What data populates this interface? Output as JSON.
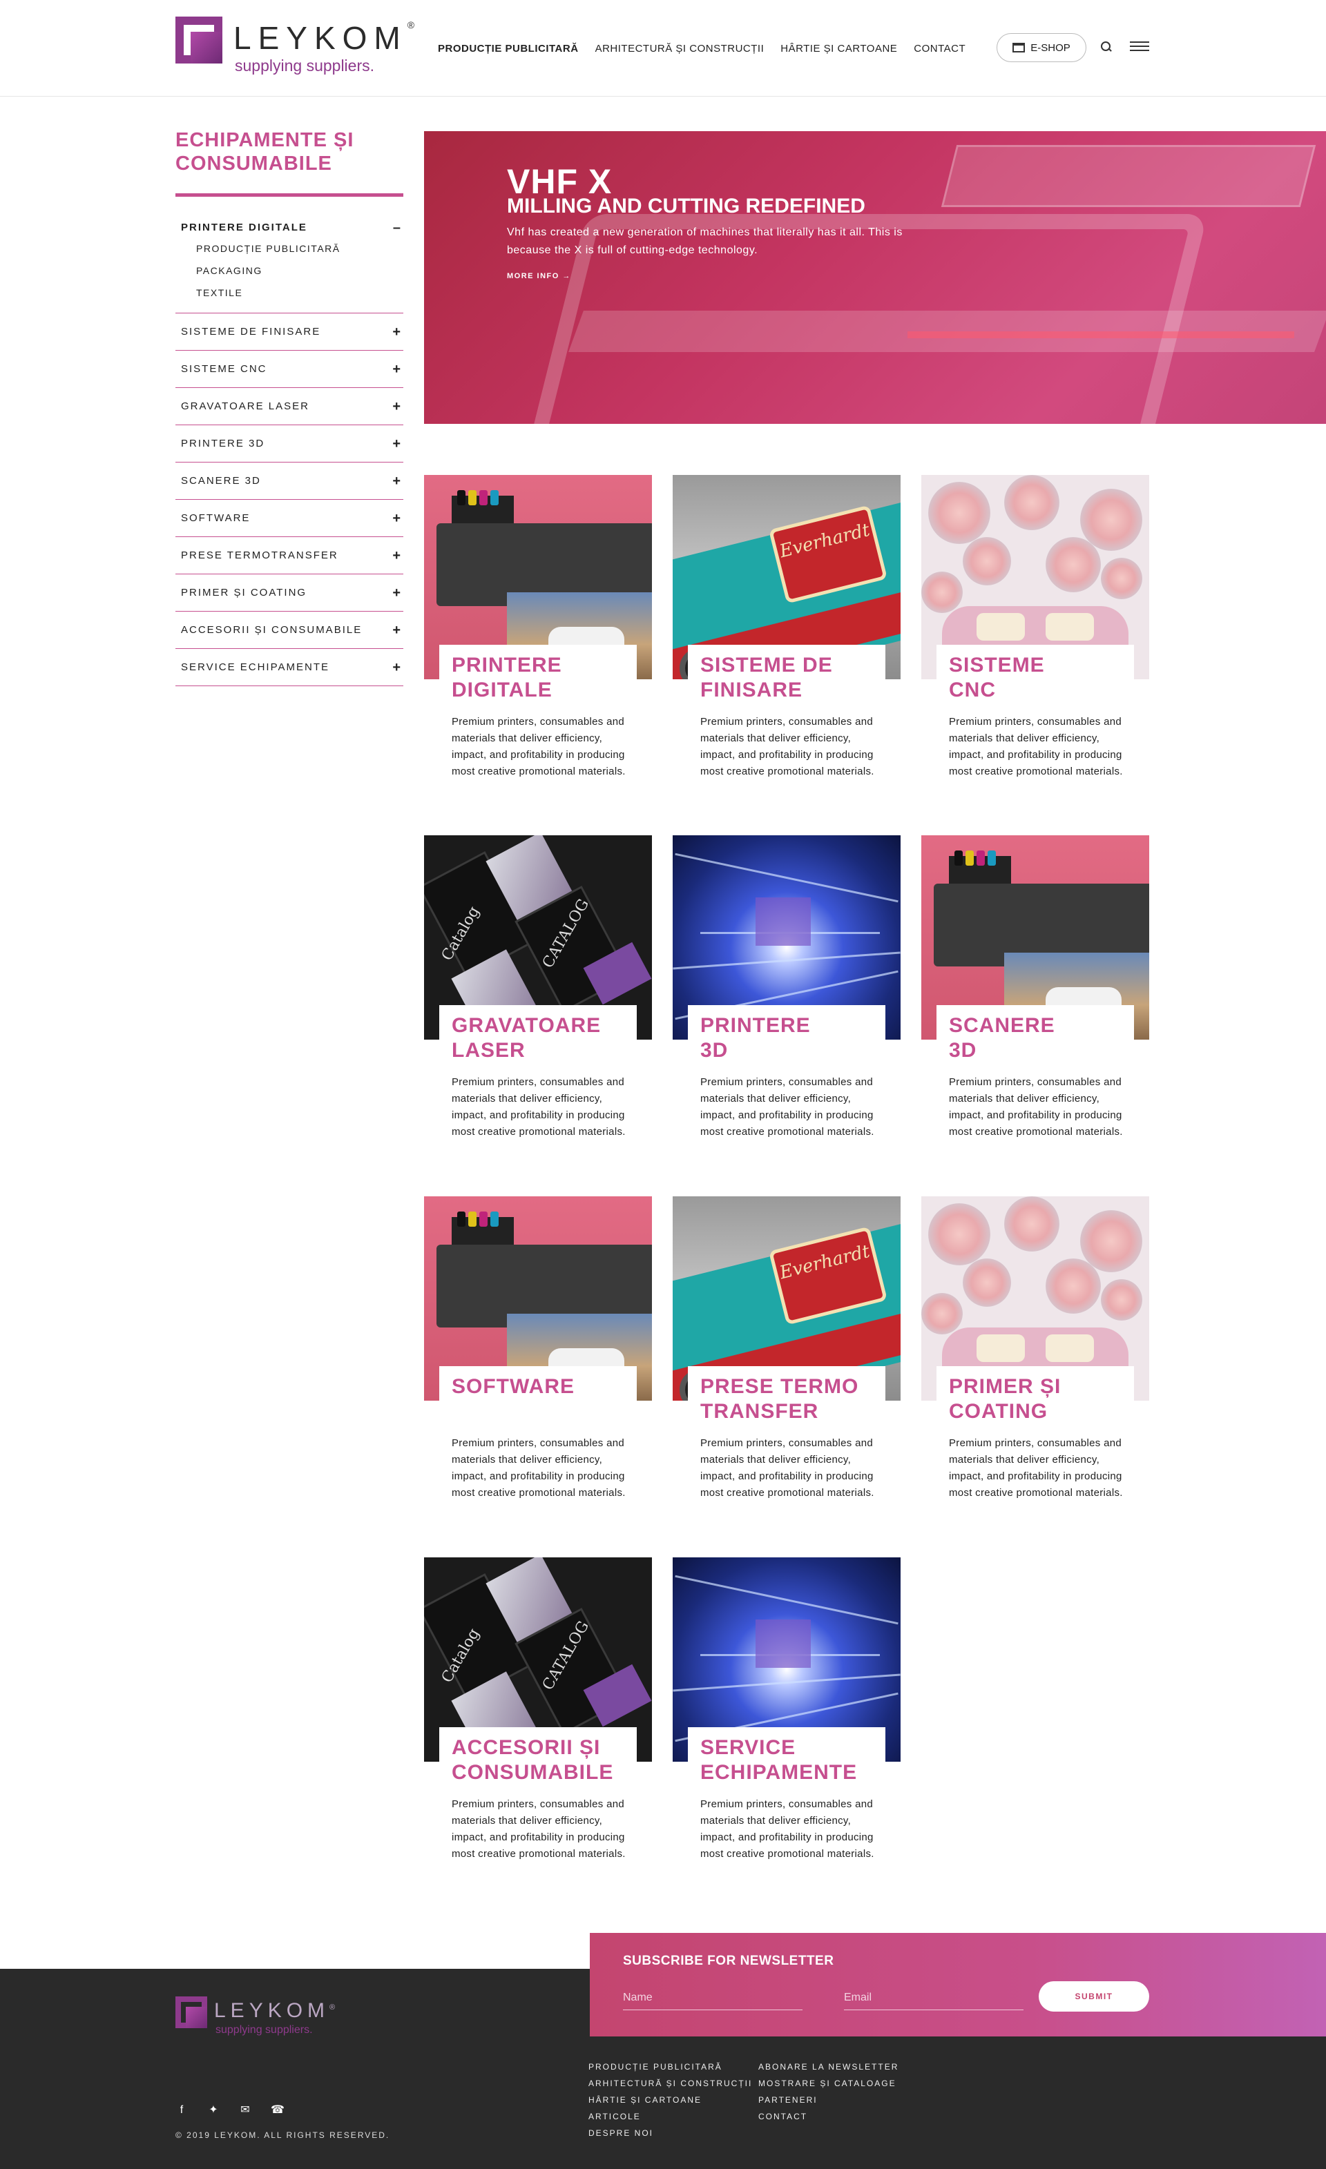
{
  "brand": {
    "name": "LEYKOM",
    "reg": "®",
    "tagline": "supplying suppliers."
  },
  "nav": {
    "items": [
      "PRODUCȚIE PUBLICITARĂ",
      "ARHITECTURĂ ȘI CONSTRUCȚII",
      "HÂRTIE ȘI CARTOANE",
      "CONTACT"
    ],
    "active_index": 0,
    "eshop": "E-SHOP"
  },
  "sidebar": {
    "title": "ECHIPAMENTE ȘI CONSUMABILE",
    "open": {
      "label": "PRINTERE DIGITALE",
      "toggle": "–",
      "subs": [
        "PRODUCȚIE PUBLICITARĂ",
        "PACKAGING",
        "TEXTILE"
      ]
    },
    "items": [
      "SISTEME DE FINISARE",
      "SISTEME CNC",
      "GRAVATOARE LASER",
      "PRINTERE 3D",
      "SCANERE 3D",
      "SOFTWARE",
      "PRESE TERMOTRANSFER",
      "PRIMER ȘI COATING",
      "ACCESORII ȘI CONSUMABILE",
      "SERVICE ECHIPAMENTE"
    ],
    "toggle": "+"
  },
  "hero": {
    "title": "VHF X",
    "subtitle": "MILLING AND CUTTING REDEFINED",
    "text": "Vhf has created a new generation of machines that literally has it all. This is because the X is full of cutting-edge technology.",
    "more": "MORE INFO →"
  },
  "cards": {
    "description": "Premium printers, consumables and materials that deliver efficiency, impact, and profitability in producing most creative promotional materials.",
    "items": [
      {
        "line1": "PRINTERE",
        "line2": "DIGITALE"
      },
      {
        "line1": "SISTEME DE",
        "line2": "FINISARE"
      },
      {
        "line1": "SISTEME",
        "line2": "CNC"
      },
      {
        "line1": "GRAVATOARE",
        "line2": "LASER"
      },
      {
        "line1": "PRINTERE",
        "line2": "3D"
      },
      {
        "line1": "SCANERE",
        "line2": "3D"
      },
      {
        "line1": "SOFTWARE",
        "line2": ""
      },
      {
        "line1": "PRESE TERMO",
        "line2": "TRANSFER"
      },
      {
        "line1": "PRIMER ȘI",
        "line2": "COATING"
      },
      {
        "line1": "ACCESORII ȘI",
        "line2": "CONSUMABILE"
      },
      {
        "line1": "SERVICE",
        "line2": "ECHIPAMENTE"
      }
    ]
  },
  "newsletter": {
    "title": "SUBSCRIBE FOR NEWSLETTER",
    "name_placeholder": "Name",
    "email_placeholder": "Email",
    "submit": "SUBMIT"
  },
  "footer": {
    "links_col1": [
      "PRODUCȚIE PUBLICITARĂ",
      "ARHITECTURĂ ȘI CONSTRUCȚII",
      "HÂRTIE ȘI CARTOANE",
      "ARTICOLE",
      "DESPRE NOI"
    ],
    "links_col2": [
      "ABONARE LA NEWSLETTER",
      "MOSTRARE ȘI CATALOAGE",
      "PARTENERI",
      "CONTACT"
    ],
    "copyright": "© 2019 LEYKOM. ALL RIGHTS RESERVED.",
    "socials": [
      "facebook-icon",
      "twitter-icon",
      "mail-icon",
      "phone-icon"
    ]
  },
  "colors": {
    "accent": "#c64f8f",
    "footer_bg": "#2a2a2a",
    "brand_purple": "#8e3a8c"
  }
}
